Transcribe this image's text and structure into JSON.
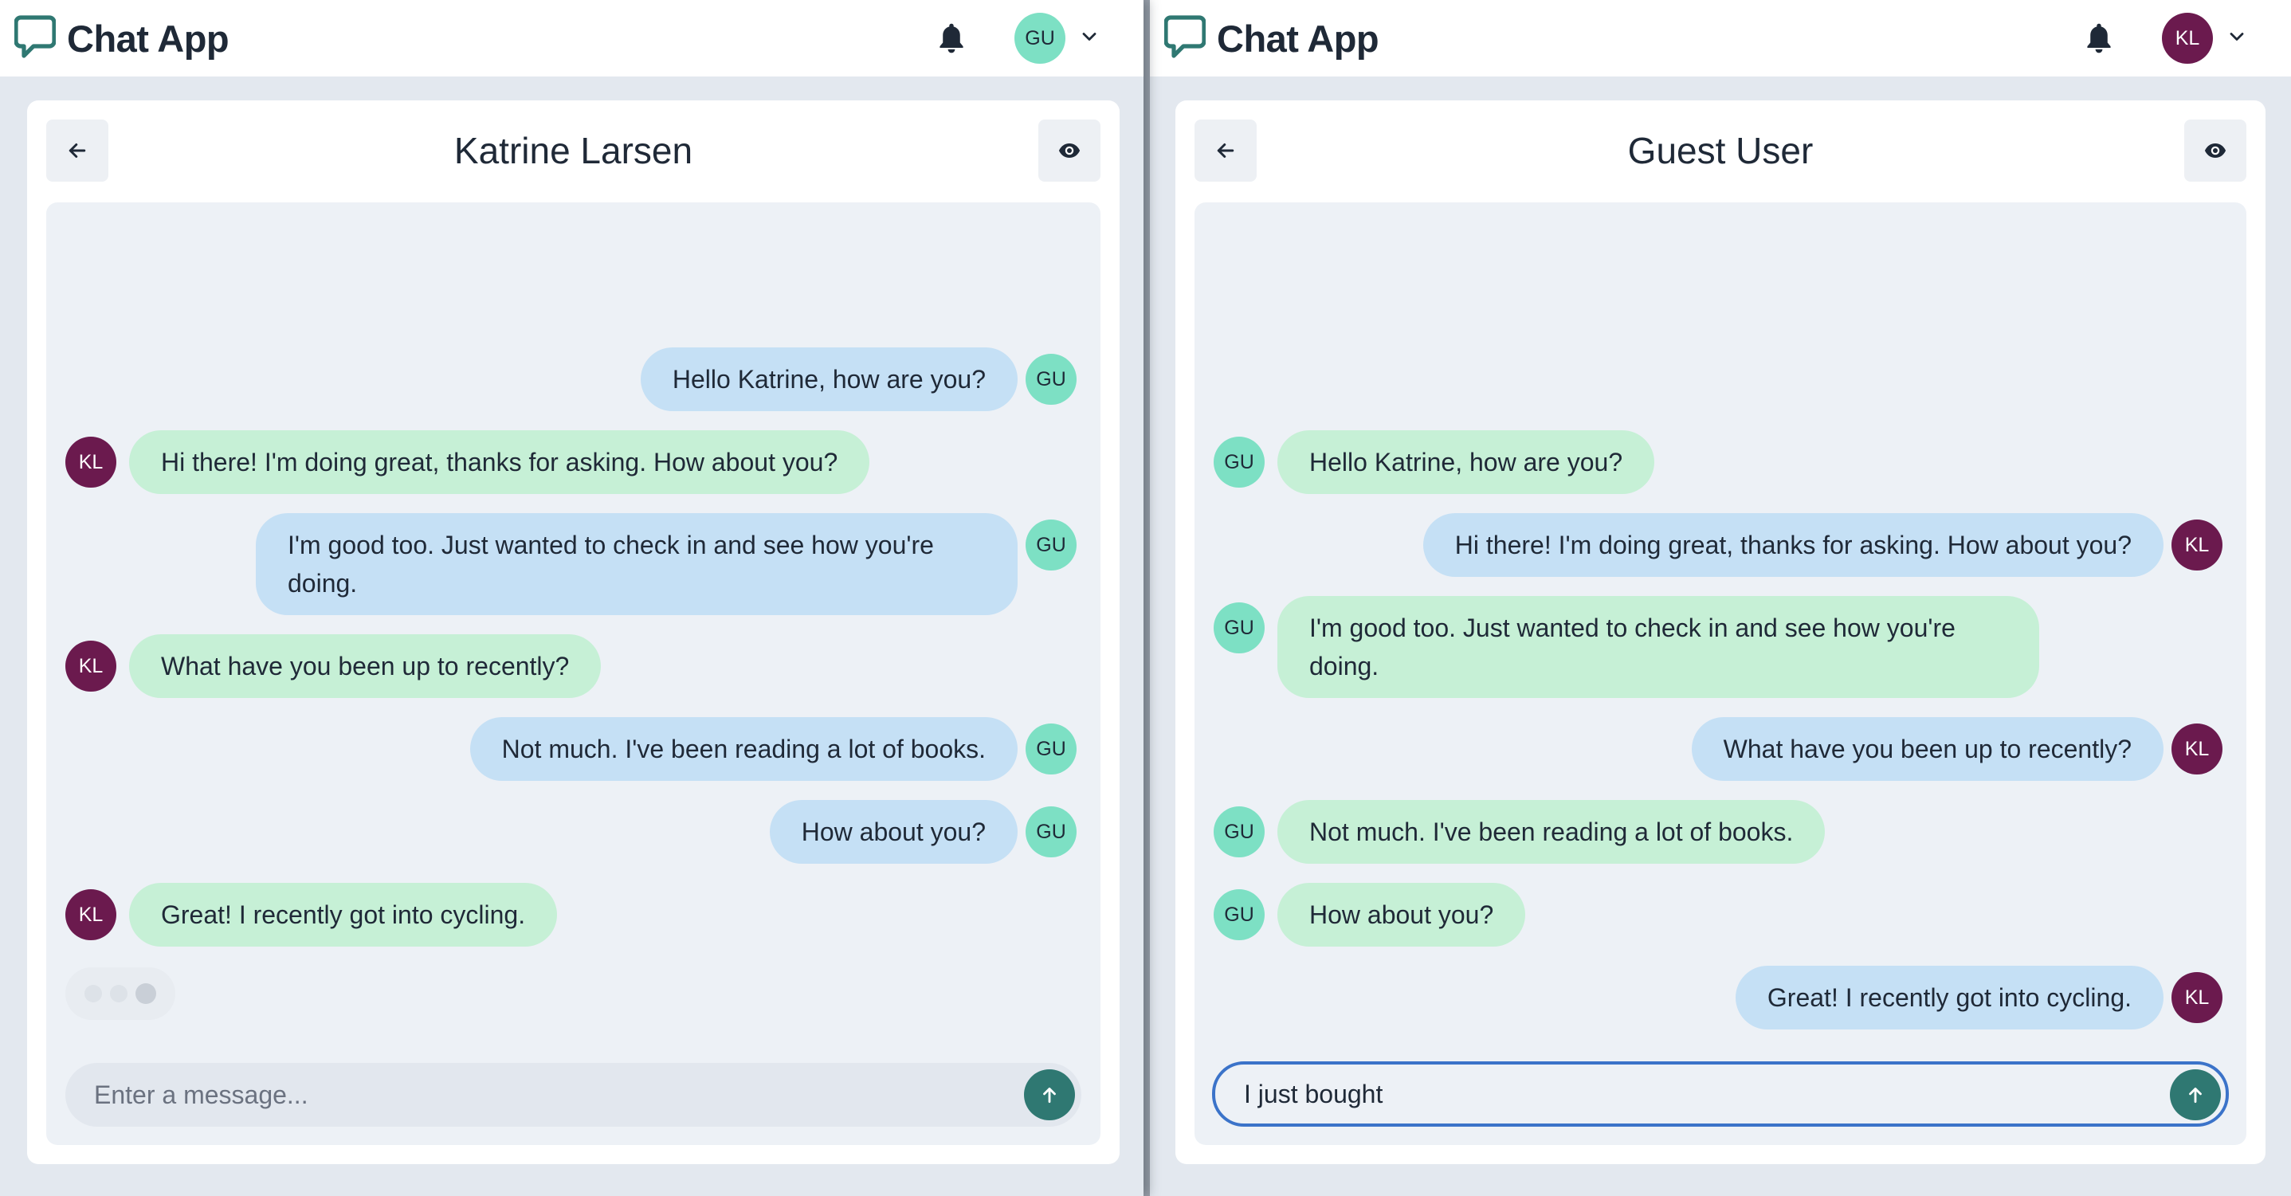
{
  "left": {
    "app_name": "Chat App",
    "user_avatar": {
      "initials": "GU",
      "bg": "#7de0c4"
    },
    "chat_title": "Katrine Larsen",
    "input": {
      "value": "",
      "placeholder": "Enter a message..."
    },
    "messages": [
      {
        "from": "GU",
        "side": "right",
        "color": "blue",
        "text": "Hello Katrine, how are you?"
      },
      {
        "from": "KL",
        "side": "left",
        "color": "green",
        "text": "Hi there! I'm doing great, thanks for asking. How about you?"
      },
      {
        "from": "GU",
        "side": "right",
        "color": "blue",
        "text": "I'm good too. Just wanted to check in and see how you're doing."
      },
      {
        "from": "KL",
        "side": "left",
        "color": "green",
        "text": "What have you been up to recently?"
      },
      {
        "from": "GU",
        "side": "right",
        "color": "blue",
        "text": "Not much. I've been reading a lot of books."
      },
      {
        "from": "GU",
        "side": "right",
        "color": "blue",
        "text": "How about you?"
      },
      {
        "from": "KL",
        "side": "left",
        "color": "green",
        "text": "Great! I recently got into cycling."
      }
    ],
    "typing_indicator": true
  },
  "right": {
    "app_name": "Chat App",
    "user_avatar": {
      "initials": "KL",
      "bg": "#6b1a4e"
    },
    "chat_title": "Guest User",
    "input": {
      "value": "I just bought",
      "placeholder": "Enter a message..."
    },
    "messages": [
      {
        "from": "GU",
        "side": "left",
        "color": "green",
        "text": "Hello Katrine, how are you?"
      },
      {
        "from": "KL",
        "side": "right",
        "color": "blue",
        "text": "Hi there! I'm doing great, thanks for asking. How about you?"
      },
      {
        "from": "GU",
        "side": "left",
        "color": "green",
        "text": "I'm good too. Just wanted to check in and see how you're doing."
      },
      {
        "from": "KL",
        "side": "right",
        "color": "blue",
        "text": "What have you been up to recently?"
      },
      {
        "from": "GU",
        "side": "left",
        "color": "green",
        "text": "Not much. I've been reading a lot of books."
      },
      {
        "from": "GU",
        "side": "left",
        "color": "green",
        "text": "How about you?"
      },
      {
        "from": "KL",
        "side": "right",
        "color": "blue",
        "text": "Great! I recently got into cycling."
      }
    ]
  },
  "icons": {
    "logo": "chat-bubble-icon",
    "notifications": "bell-icon",
    "menu": "chevron-down-icon",
    "back": "arrow-left-icon",
    "view": "eye-icon",
    "send": "arrow-up-icon"
  },
  "colors": {
    "brand": "#2f7872",
    "sent_bubble": "#c5e0f5",
    "received_bubble": "#c6f0d6",
    "gu_avatar": "#7de0c4",
    "kl_avatar": "#6b1a4e",
    "focus_ring": "#3b73c9"
  }
}
